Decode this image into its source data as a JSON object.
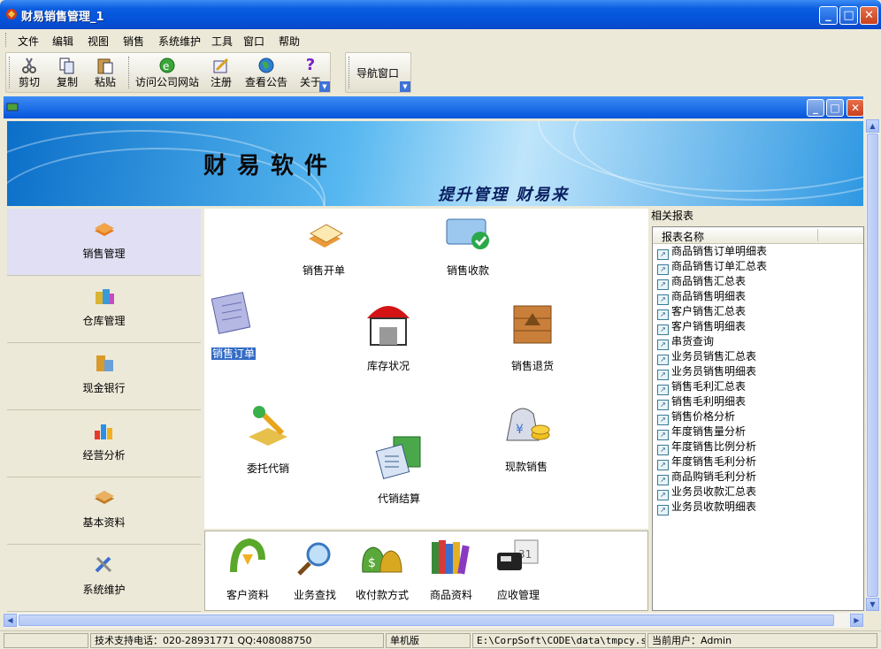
{
  "window": {
    "title": "财易销售管理_1",
    "min": "_",
    "max": "□",
    "close": "✕"
  },
  "menu": [
    "文件",
    "编辑",
    "视图",
    "销售",
    "系统维护",
    "工具",
    "窗口",
    "帮助"
  ],
  "toolbar": {
    "buttons": [
      {
        "label": "剪切",
        "icon": "cut-icon"
      },
      {
        "label": "复制",
        "icon": "copy-icon"
      },
      {
        "label": "粘贴",
        "icon": "paste-icon"
      },
      {
        "label": "访问公司网站",
        "icon": "web-icon"
      },
      {
        "label": "注册",
        "icon": "register-icon"
      },
      {
        "label": "查看公告",
        "icon": "globe-icon"
      },
      {
        "label": "关于",
        "icon": "help-icon"
      }
    ],
    "nav_window": "导航窗口"
  },
  "banner": {
    "title": "财易软件",
    "slogan": "提升管理 财易来"
  },
  "sidebar": [
    {
      "label": "销售管理",
      "icon": "sales-icon",
      "active": true
    },
    {
      "label": "仓库管理",
      "icon": "warehouse-icon"
    },
    {
      "label": "现金银行",
      "icon": "bank-icon"
    },
    {
      "label": "经营分析",
      "icon": "analysis-icon"
    },
    {
      "label": "基本资料",
      "icon": "book-icon"
    },
    {
      "label": "系统维护",
      "icon": "tools-icon"
    }
  ],
  "center": {
    "nodes": [
      {
        "label": "销售开单",
        "icon": "sales-order-icon"
      },
      {
        "label": "销售收款",
        "icon": "receipt-icon"
      },
      {
        "label": "销售订单",
        "icon": "order-icon",
        "selected": true
      },
      {
        "label": "库存状况",
        "icon": "store-icon"
      },
      {
        "label": "销售退货",
        "icon": "return-box-icon"
      },
      {
        "label": "委托代销",
        "icon": "consign-icon"
      },
      {
        "label": "现款销售",
        "icon": "money-bag-icon"
      },
      {
        "label": "代销结算",
        "icon": "calculator-icon"
      }
    ]
  },
  "bottom_panel": [
    {
      "label": "客户资料",
      "icon": "customer-icon"
    },
    {
      "label": "业务查找",
      "icon": "search-icon"
    },
    {
      "label": "收付款方式",
      "icon": "payment-icon"
    },
    {
      "label": "商品资料",
      "icon": "goods-icon"
    },
    {
      "label": "应收管理",
      "icon": "receivable-icon"
    }
  ],
  "reports": {
    "heading": "相关报表",
    "column": "报表名称",
    "items": [
      "商品销售订单明细表",
      "商品销售订单汇总表",
      "商品销售汇总表",
      "商品销售明细表",
      "客户销售汇总表",
      "客户销售明细表",
      "串货查询",
      "业务员销售汇总表",
      "业务员销售明细表",
      "销售毛利汇总表",
      "销售毛利明细表",
      "销售价格分析",
      "年度销售量分析",
      "年度销售比例分析",
      "年度销售毛利分析",
      "商品购销毛利分析",
      "业务员收款汇总表",
      "业务员收款明细表"
    ]
  },
  "status": {
    "support": "技术支持电话：020-28931771 QQ:408088750",
    "mode": "单机版",
    "path": "E:\\CorpSoft\\CODE\\data\\tmpcy.sys",
    "user": "当前用户：Admin"
  },
  "colors": {
    "accent": "#0a5ce0",
    "selection": "#316ac5",
    "close": "#c8411d"
  }
}
